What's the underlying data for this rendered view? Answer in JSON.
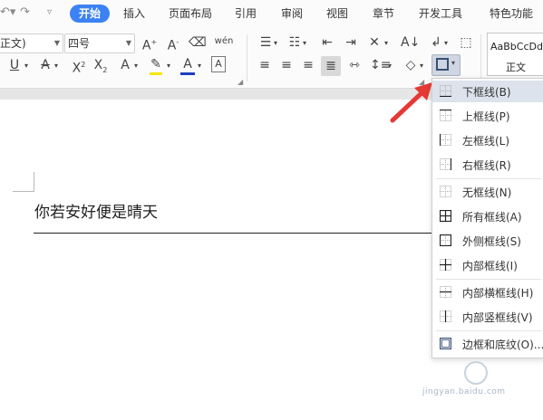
{
  "tabs": [
    "开始",
    "插入",
    "页面布局",
    "引用",
    "审阅",
    "视图",
    "章节",
    "开发工具",
    "特色功能"
  ],
  "font_combo": {
    "value": "正文)"
  },
  "size_combo": {
    "value": "四号"
  },
  "styles": {
    "preview": "AaBbCcDd",
    "name": "正文"
  },
  "document": {
    "text": "你若安好便是晴天"
  },
  "menu": {
    "items": [
      {
        "label": "下框线(B)",
        "icon": "bottom-border-icon"
      },
      {
        "label": "上框线(P)",
        "icon": "top-border-icon"
      },
      {
        "label": "左框线(L)",
        "icon": "left-border-icon"
      },
      {
        "label": "右框线(R)",
        "icon": "right-border-icon"
      },
      {
        "label": "无框线(N)",
        "icon": "no-border-icon"
      },
      {
        "label": "所有框线(A)",
        "icon": "all-borders-icon"
      },
      {
        "label": "外侧框线(S)",
        "icon": "outside-borders-icon"
      },
      {
        "label": "内部框线(I)",
        "icon": "inside-borders-icon"
      },
      {
        "label": "内部横框线(H)",
        "icon": "inside-horizontal-border-icon"
      },
      {
        "label": "内部竖框线(V)",
        "icon": "inside-vertical-border-icon"
      },
      {
        "label": "边框和底纹(O)...",
        "icon": "borders-and-shading-icon"
      }
    ]
  },
  "watermark": {
    "text": "jingyan.baidu.com"
  },
  "colors": {
    "accent": "#3d82f4",
    "arrow": "#e53935",
    "font_color_bar": "#1f3fbf",
    "highlight_bar": "#f5e600",
    "menu_highlight": "#dde3ec"
  }
}
